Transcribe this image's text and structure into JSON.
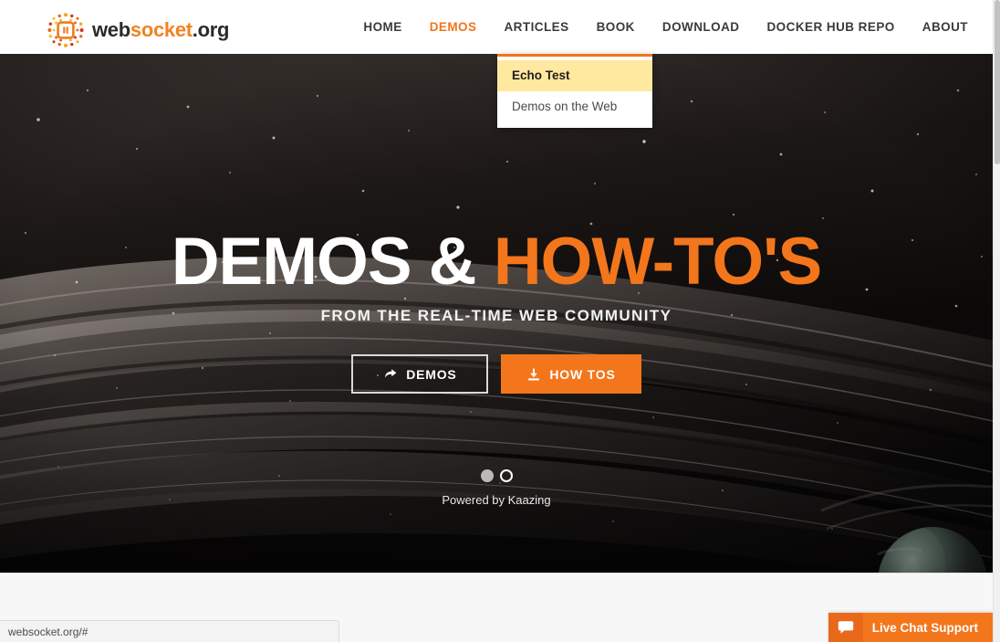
{
  "header": {
    "logo": {
      "icon": "websocket-chip-icon",
      "text_web": "web",
      "text_socket": "socket",
      "text_org": ".org"
    },
    "nav_items": [
      {
        "label": "HOME",
        "active": false
      },
      {
        "label": "DEMOS",
        "active": true
      },
      {
        "label": "ARTICLES",
        "active": false
      },
      {
        "label": "BOOK",
        "active": false
      },
      {
        "label": "DOWNLOAD",
        "active": false
      },
      {
        "label": "DOCKER HUB REPO",
        "active": false
      },
      {
        "label": "ABOUT",
        "active": false
      }
    ]
  },
  "dropdown": {
    "items": [
      {
        "label": "Echo Test",
        "highlighted": true
      },
      {
        "label": "Demos on the Web",
        "highlighted": false
      }
    ]
  },
  "hero": {
    "title_white": "DEMOS &",
    "title_orange": "HOW-TO'S",
    "subtitle": "FROM THE REAL-TIME WEB COMMUNITY",
    "buttons": [
      {
        "label": "DEMOS",
        "icon": "share-arrow-icon",
        "style": "ghost"
      },
      {
        "label": "HOW TOS",
        "icon": "download-icon",
        "style": "solid"
      }
    ],
    "carousel": {
      "slide_count": 2,
      "active_index": 0
    },
    "powered_by": "Powered by Kaazing"
  },
  "live_chat": {
    "label": "Live Chat Support",
    "icon": "chat-bubble-icon"
  },
  "status_bar": {
    "url": "websocket.org/#"
  },
  "colors": {
    "brand_orange": "#f3761c",
    "nav_text": "#3b3b3b",
    "highlight_yellow": "#ffe8a0",
    "hero_dark": "#0a0809"
  }
}
